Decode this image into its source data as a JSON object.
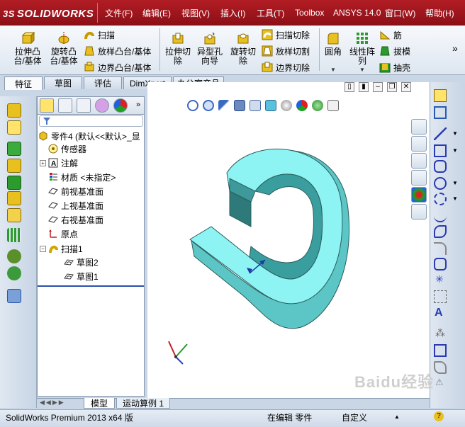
{
  "app": {
    "logo_prefix": "3S",
    "logo_text": "SOLIDWORKS"
  },
  "menu": {
    "items": [
      "文件(F)",
      "编辑(E)",
      "视图(V)",
      "插入(I)",
      "工具(T)",
      "Toolbox",
      "ANSYS 14.0",
      "窗口(W)",
      "帮助(H)"
    ]
  },
  "commands": {
    "extrude_boss": "拉伸凸\n台/基体",
    "revolve_boss": "旋转凸\n台/基体",
    "sweep": "扫描",
    "loft_boss": "放样凸台/基体",
    "boundary_boss": "边界凸台/基体",
    "extrude_cut": "拉伸切\n除",
    "hole_wizard": "异型孔\n向导",
    "revolve_cut": "旋转切\n除",
    "swept_cut": "扫描切除",
    "lofted_cut": "放样切割",
    "boundary_cut": "边界切除",
    "fillet": "圆角",
    "linear_pattern": "线性阵\n列",
    "rib": "筋",
    "draft": "拔模",
    "shell": "抽壳",
    "overflow": "»"
  },
  "tabs": [
    "特征",
    "草图",
    "评估",
    "DimXpert",
    "办公室产品"
  ],
  "tree": {
    "filter_icon": "funnel-icon",
    "root": "零件4  (默认<<默认>_显",
    "items": [
      {
        "label": "传感器",
        "icon": "sensor-icon",
        "expander": ""
      },
      {
        "label": "注解",
        "icon": "annotation-icon",
        "expander": "+"
      },
      {
        "label": "材质 <未指定>",
        "icon": "material-icon",
        "expander": ""
      },
      {
        "label": "前视基准面",
        "icon": "plane-icon",
        "expander": ""
      },
      {
        "label": "上视基准面",
        "icon": "plane-icon",
        "expander": ""
      },
      {
        "label": "右视基准面",
        "icon": "plane-icon",
        "expander": ""
      },
      {
        "label": "原点",
        "icon": "origin-icon",
        "expander": ""
      },
      {
        "label": "扫描1",
        "icon": "sweep-icon",
        "expander": "−"
      }
    ],
    "children": [
      {
        "label": "草图2",
        "icon": "sketch-icon"
      },
      {
        "label": "草图1",
        "icon": "sketch-icon"
      }
    ]
  },
  "bottom_tabs": [
    "模型",
    "运动算例 1"
  ],
  "status": {
    "product": "SolidWorks Premium 2013 x64 版",
    "mode": "在编辑 零件",
    "units": "自定义",
    "help": "?"
  },
  "watermark": "Baidu经验",
  "colors": {
    "menubar": "#a3161e",
    "model_face": "#8ef0f0",
    "model_side": "#4fb8b8",
    "model_dark": "#2e7d7d"
  }
}
